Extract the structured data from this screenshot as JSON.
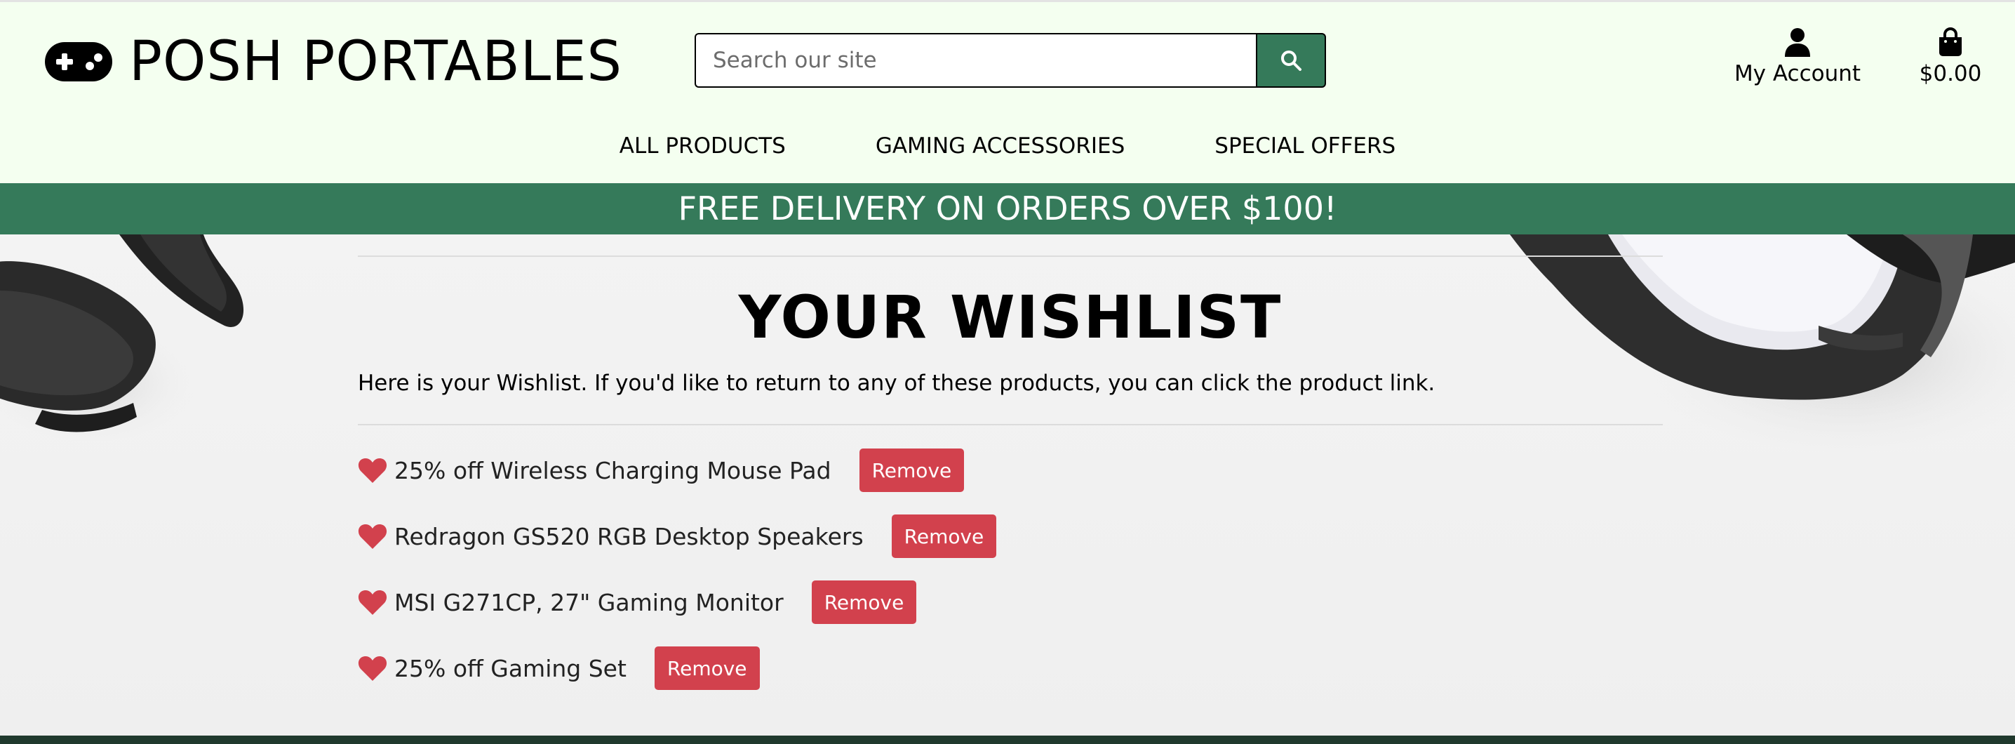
{
  "brand": {
    "name": "POSH PORTABLES"
  },
  "search": {
    "placeholder": "Search our site"
  },
  "account": {
    "label": "My Account"
  },
  "cart": {
    "total": "$0.00"
  },
  "nav": [
    {
      "label": "ALL PRODUCTS"
    },
    {
      "label": "GAMING ACCESSORIES"
    },
    {
      "label": "SPECIAL OFFERS"
    }
  ],
  "banner": {
    "text": "FREE DELIVERY ON ORDERS OVER $100!"
  },
  "wishlist": {
    "title": "YOUR WISHLIST",
    "intro": "Here is your Wishlist. If you'd like to return to any of these products, you can click the product link.",
    "remove_label": "Remove",
    "items": [
      {
        "name": "25% off Wireless Charging Mouse Pad"
      },
      {
        "name": "Redragon GS520 RGB Desktop Speakers"
      },
      {
        "name": "MSI G271CP, 27\" Gaming Monitor"
      },
      {
        "name": "25% off Gaming Set"
      }
    ]
  },
  "colors": {
    "header_bg": "#f4fff0",
    "accent_green": "#357a5a",
    "remove_red": "#d2414d",
    "footer": "#20392d"
  },
  "icons": [
    "gamepad-icon",
    "search-icon",
    "user-icon",
    "shopping-bag-icon",
    "heart-icon"
  ]
}
